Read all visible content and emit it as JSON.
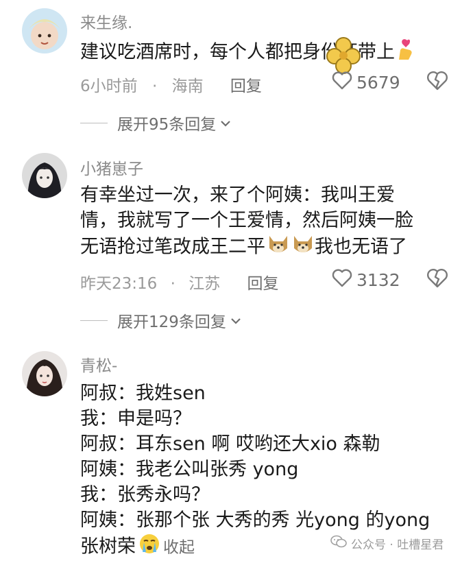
{
  "comments": [
    {
      "username": "来生缘.",
      "body": [
        "建议吃酒席时，每个人都把身份证带上"
      ],
      "time": "6小时前",
      "separator": "·",
      "location": "海南",
      "reply": "回复",
      "likes": "5679",
      "expand": "展开95条回复"
    },
    {
      "username": "小猪崽子",
      "body": [
        "有幸坐过一次，来了个阿姨：我叫王爱",
        "情，我就写了一个王爱情，然后阿姨一脸",
        "无语抢过笔改成王二平",
        "我也无语了"
      ],
      "time": "昨天23:16",
      "separator": "·",
      "location": "江苏",
      "reply": "回复",
      "likes": "3132",
      "expand": "展开129条回复"
    },
    {
      "username": "青松-",
      "body": [
        "阿叔：我姓sen",
        "我：申是吗？",
        "阿叔：耳东sen 啊  哎哟还大xio 森勒",
        " 阿姨：我老公叫张秀 yong",
        "我：张秀永吗？",
        "阿姨：张那个张 大秀的秀 光yong 的yong",
        "张树荣"
      ],
      "collapse": "收起"
    }
  ],
  "watermark": {
    "text": "公众号 · 吐槽星君"
  },
  "icons": {
    "heart": "heart-outline-icon",
    "dislike": "broken-heart-icon",
    "chevron": "chevron-down-icon",
    "finger_heart": "finger-heart-emoji-icon",
    "dog": "doge-emoji-icon",
    "cry": "crying-emoji-icon",
    "badge": "gold-badge-icon",
    "wechat": "wechat-icon"
  }
}
